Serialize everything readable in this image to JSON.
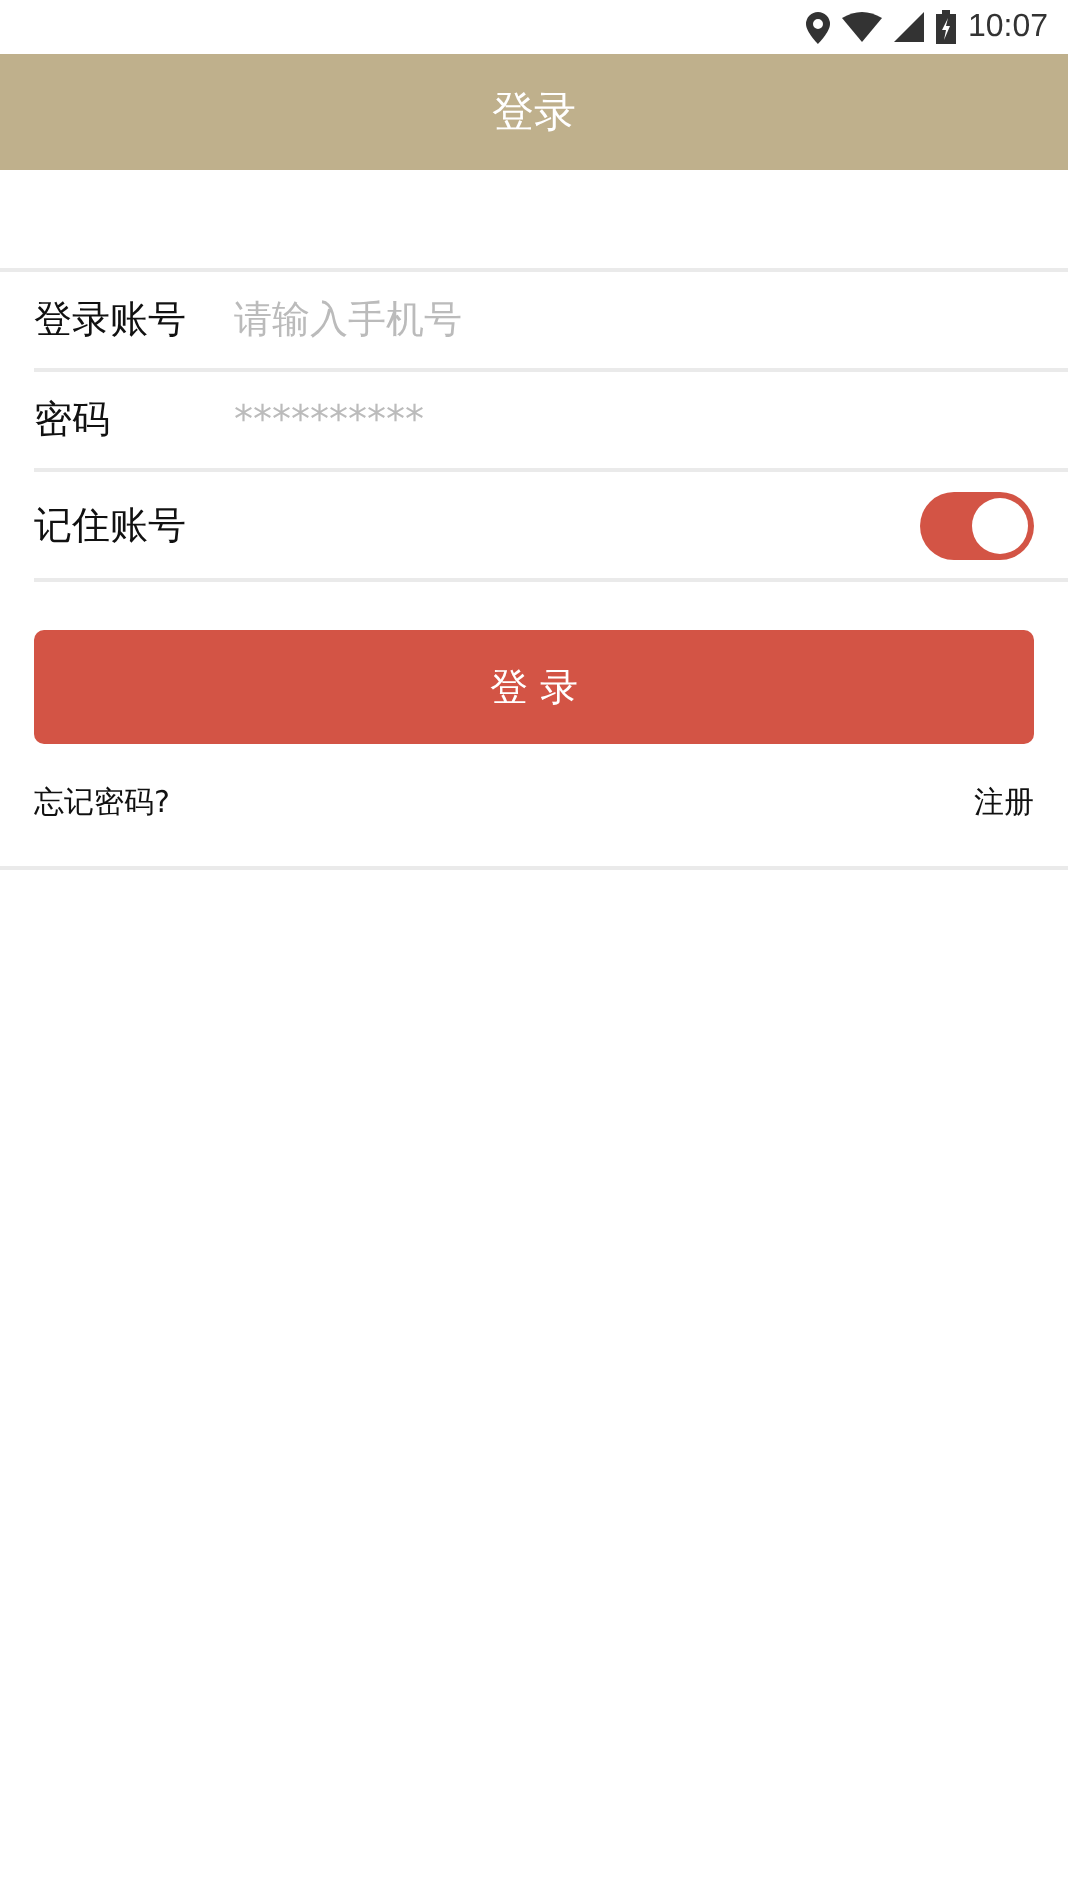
{
  "status_bar": {
    "time": "10:07"
  },
  "header": {
    "title": "登录"
  },
  "form": {
    "account": {
      "label": "登录账号",
      "placeholder": "请输入手机号"
    },
    "password": {
      "label": "密码",
      "placeholder": "**********"
    },
    "remember": {
      "label": "记住账号",
      "on": true
    }
  },
  "login_button": "登 录",
  "links": {
    "forgot": "忘记密码?",
    "register": "注册"
  }
}
